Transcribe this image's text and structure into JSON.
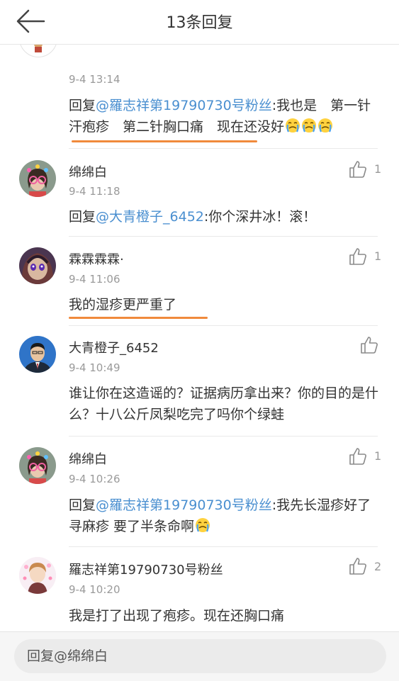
{
  "header": {
    "title": "13条回复"
  },
  "comments": [
    {
      "username": "",
      "time": "9-4 13:14",
      "reply_prefix": "回复",
      "mention": "@羅志祥第19790730号粉丝",
      "text": ":我也是　第一针汗疱疹　第二针胸口痛　现在还没好",
      "like_count": ""
    },
    {
      "username": "绵绵白",
      "time": "9-4 11:18",
      "reply_prefix": "回复",
      "mention": "@大青橙子_6452",
      "text": ":你个深井冰！滚！",
      "like_count": "1"
    },
    {
      "username": "霖霖霖霖·",
      "time": "9-4 11:06",
      "text": "我的湿疹更严重了",
      "like_count": "1"
    },
    {
      "username": "大青橙子_6452",
      "time": "9-4 10:49",
      "text": "谁让你在这造谣的？证据病历拿出来？你的目的是什么？十八公斤凤梨吃完了吗你个绿蛙",
      "like_count": ""
    },
    {
      "username": "绵绵白",
      "time": "9-4 10:26",
      "reply_prefix": "回复",
      "mention": "@羅志祥第19790730号粉丝",
      "text": ":我先长湿疹好了寻麻疹 要了半条命啊",
      "like_count": "1"
    },
    {
      "username": "羅志祥第19790730号粉丝",
      "time": "9-4 10:20",
      "text": "我是打了出现了疱疹。现在还胸口痛",
      "like_count": "2"
    }
  ],
  "reply_bar": {
    "placeholder": "回复@绵绵白"
  },
  "colors": {
    "mention": "#4a8fd0",
    "highlight": "#f08a3c",
    "secondary": "#9a9a9a"
  }
}
